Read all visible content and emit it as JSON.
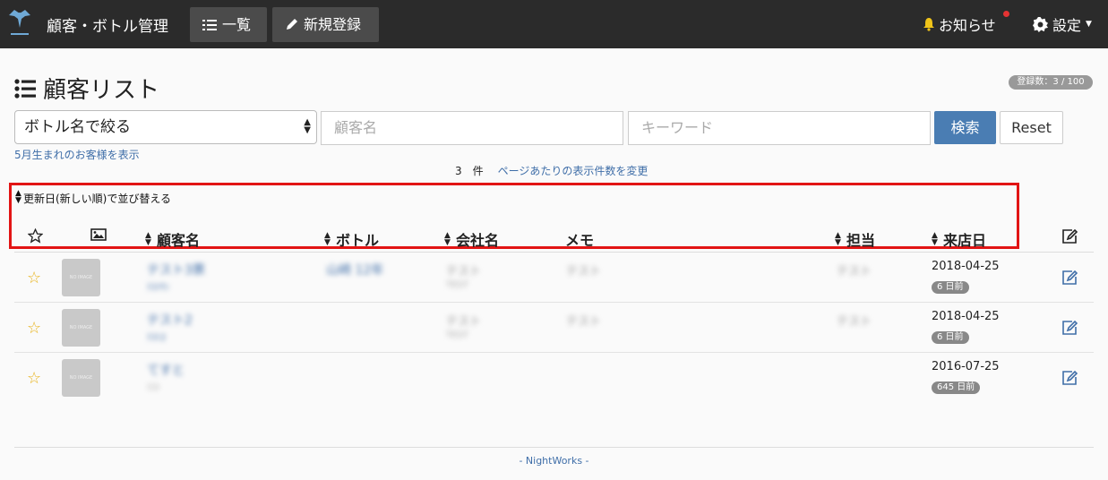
{
  "nav": {
    "brand": "顧客・ボトル管理",
    "list_label": "一覧",
    "new_label": "新規登録",
    "notice_label": "お知らせ",
    "settings_label": "設定"
  },
  "page": {
    "title": "顧客リスト",
    "count_badge": "登録数：3 / 100"
  },
  "search": {
    "bottle_select": "ボトル名で絞る",
    "name_placeholder": "顧客名",
    "keyword_placeholder": "キーワード",
    "search_button": "検索",
    "reset_button": "Reset"
  },
  "birth_link": "5月生まれのお客様を表示",
  "results": {
    "count_text": "3　件",
    "per_page_link": "ページあたりの表示件数を変更"
  },
  "sort_update": "更新日(新しい順)で並び替える",
  "table": {
    "headers": {
      "customer": "顧客名",
      "bottle": "ボトル",
      "company": "会社名",
      "memo": "メモ",
      "staff": "担当",
      "visit": "来店日"
    },
    "rows": [
      {
        "name": "テスト3票",
        "name_sub": "ﾃｽﾄｻﾝ",
        "bottle": "山崎 12年",
        "company": "テスト",
        "company_sub": "TEST",
        "memo": "テスト",
        "staff": "テスト",
        "date": "2018-04-25",
        "ago": "6 日前"
      },
      {
        "name": "テスト2",
        "name_sub": "ﾃｽﾄ2",
        "bottle": "",
        "company": "テスト",
        "company_sub": "TEST",
        "memo": "テスト",
        "staff": "テスト",
        "date": "2018-04-25",
        "ago": "6 日前"
      },
      {
        "name": "てすと",
        "name_sub": "ﾃｽﾄ",
        "bottle": "",
        "company": "",
        "company_sub": "",
        "memo": "",
        "staff": "",
        "date": "2016-07-25",
        "ago": "645 日前"
      }
    ],
    "thumb_text": "NO IMAGE"
  },
  "footer": "- NightWorks -",
  "colors": {
    "navbar": "#2b2b2b",
    "accent": "#4a7db3",
    "link": "#3f6ea8",
    "star": "#e8b31b",
    "highlight": "#e21414"
  }
}
